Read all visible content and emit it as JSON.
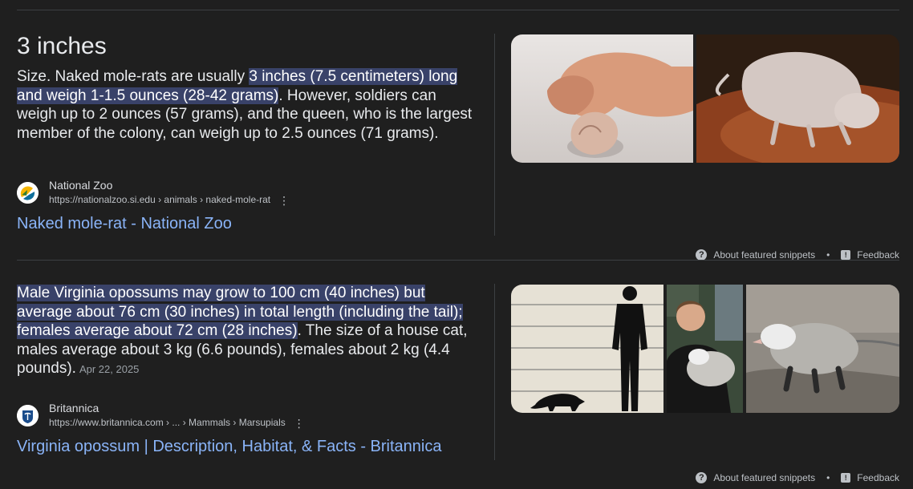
{
  "snippet1": {
    "answer": "3 inches",
    "text_before": "Size. Naked mole-rats are usually ",
    "highlight": "3 inches (7.5 centimeters) long and weigh 1-1.5 ounces (28-42 grams)",
    "text_after": ". However, soldiers can weigh up to 2 ounces (57 grams), and the queen, who is the largest member of the colony, can weigh up to 2.5 ounces (71 grams).",
    "source_name": "National Zoo",
    "source_url": "https://nationalzoo.si.edu › animals › naked-mole-rat",
    "link_title": "Naked mole-rat - National Zoo",
    "footer_about": "About featured snippets",
    "footer_feedback": "Feedback",
    "images": [
      "hand-holding-naked-mole-rat-image",
      "naked-mole-rat-on-dirt-image"
    ]
  },
  "snippet2": {
    "highlight": "Male Virginia opossums may grow to 100 cm (40 inches) but average about 76 cm (30 inches) in total length (including the tail); females average about 72 cm (28 inches)",
    "text_after": ". The size of a house cat, males average about 3 kg (6.6 pounds), females about 2 kg (4.4 pounds).",
    "date": "Apr 22, 2025",
    "source_name": "Britannica",
    "source_url": "https://www.britannica.com › ... › Mammals › Marsupials",
    "link_title": "Virginia opossum | Description, Habitat, & Facts - Britannica",
    "footer_about": "About featured snippets",
    "footer_feedback": "Feedback",
    "images": [
      "opossum-size-comparison-chart-image",
      "woman-holding-opossum-image",
      "opossum-walking-image"
    ]
  },
  "icons": {
    "more": "more-options-icon",
    "help": "help-circle-icon",
    "feedback": "feedback-icon"
  },
  "colors": {
    "background": "#1f1f1f",
    "highlight": "#394269",
    "link": "#8ab4f8",
    "divider": "#3c4043"
  }
}
